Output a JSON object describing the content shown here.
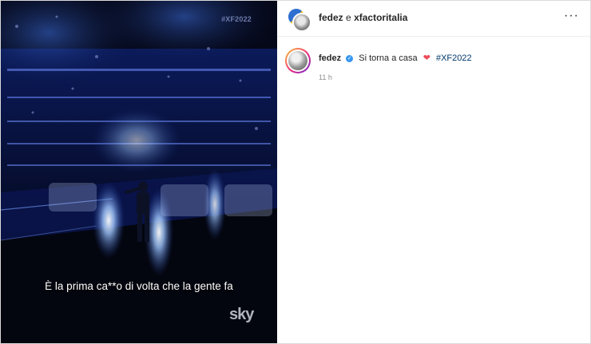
{
  "post": {
    "hashtag_overlay": "#XF2022",
    "subtitle": "È la prima ca**o di volta che la gente fa",
    "watermark": "sky"
  },
  "header": {
    "username": "fedez",
    "connector": "e",
    "collaborator": "xfactoritalia",
    "more_icon": "···"
  },
  "caption": {
    "username": "fedez",
    "verified_icon": "✓",
    "text": "Si torna a casa",
    "heart_icon": "❤",
    "hashtag": "#XF2022",
    "timestamp": "11 h"
  },
  "icons": [
    "verified-icon",
    "heart-icon",
    "more-options-icon"
  ],
  "colors": {
    "verified": "#3897f0",
    "heart": "#ed4956",
    "hashtag": "#00376b",
    "muted": "#8e8e8e"
  }
}
